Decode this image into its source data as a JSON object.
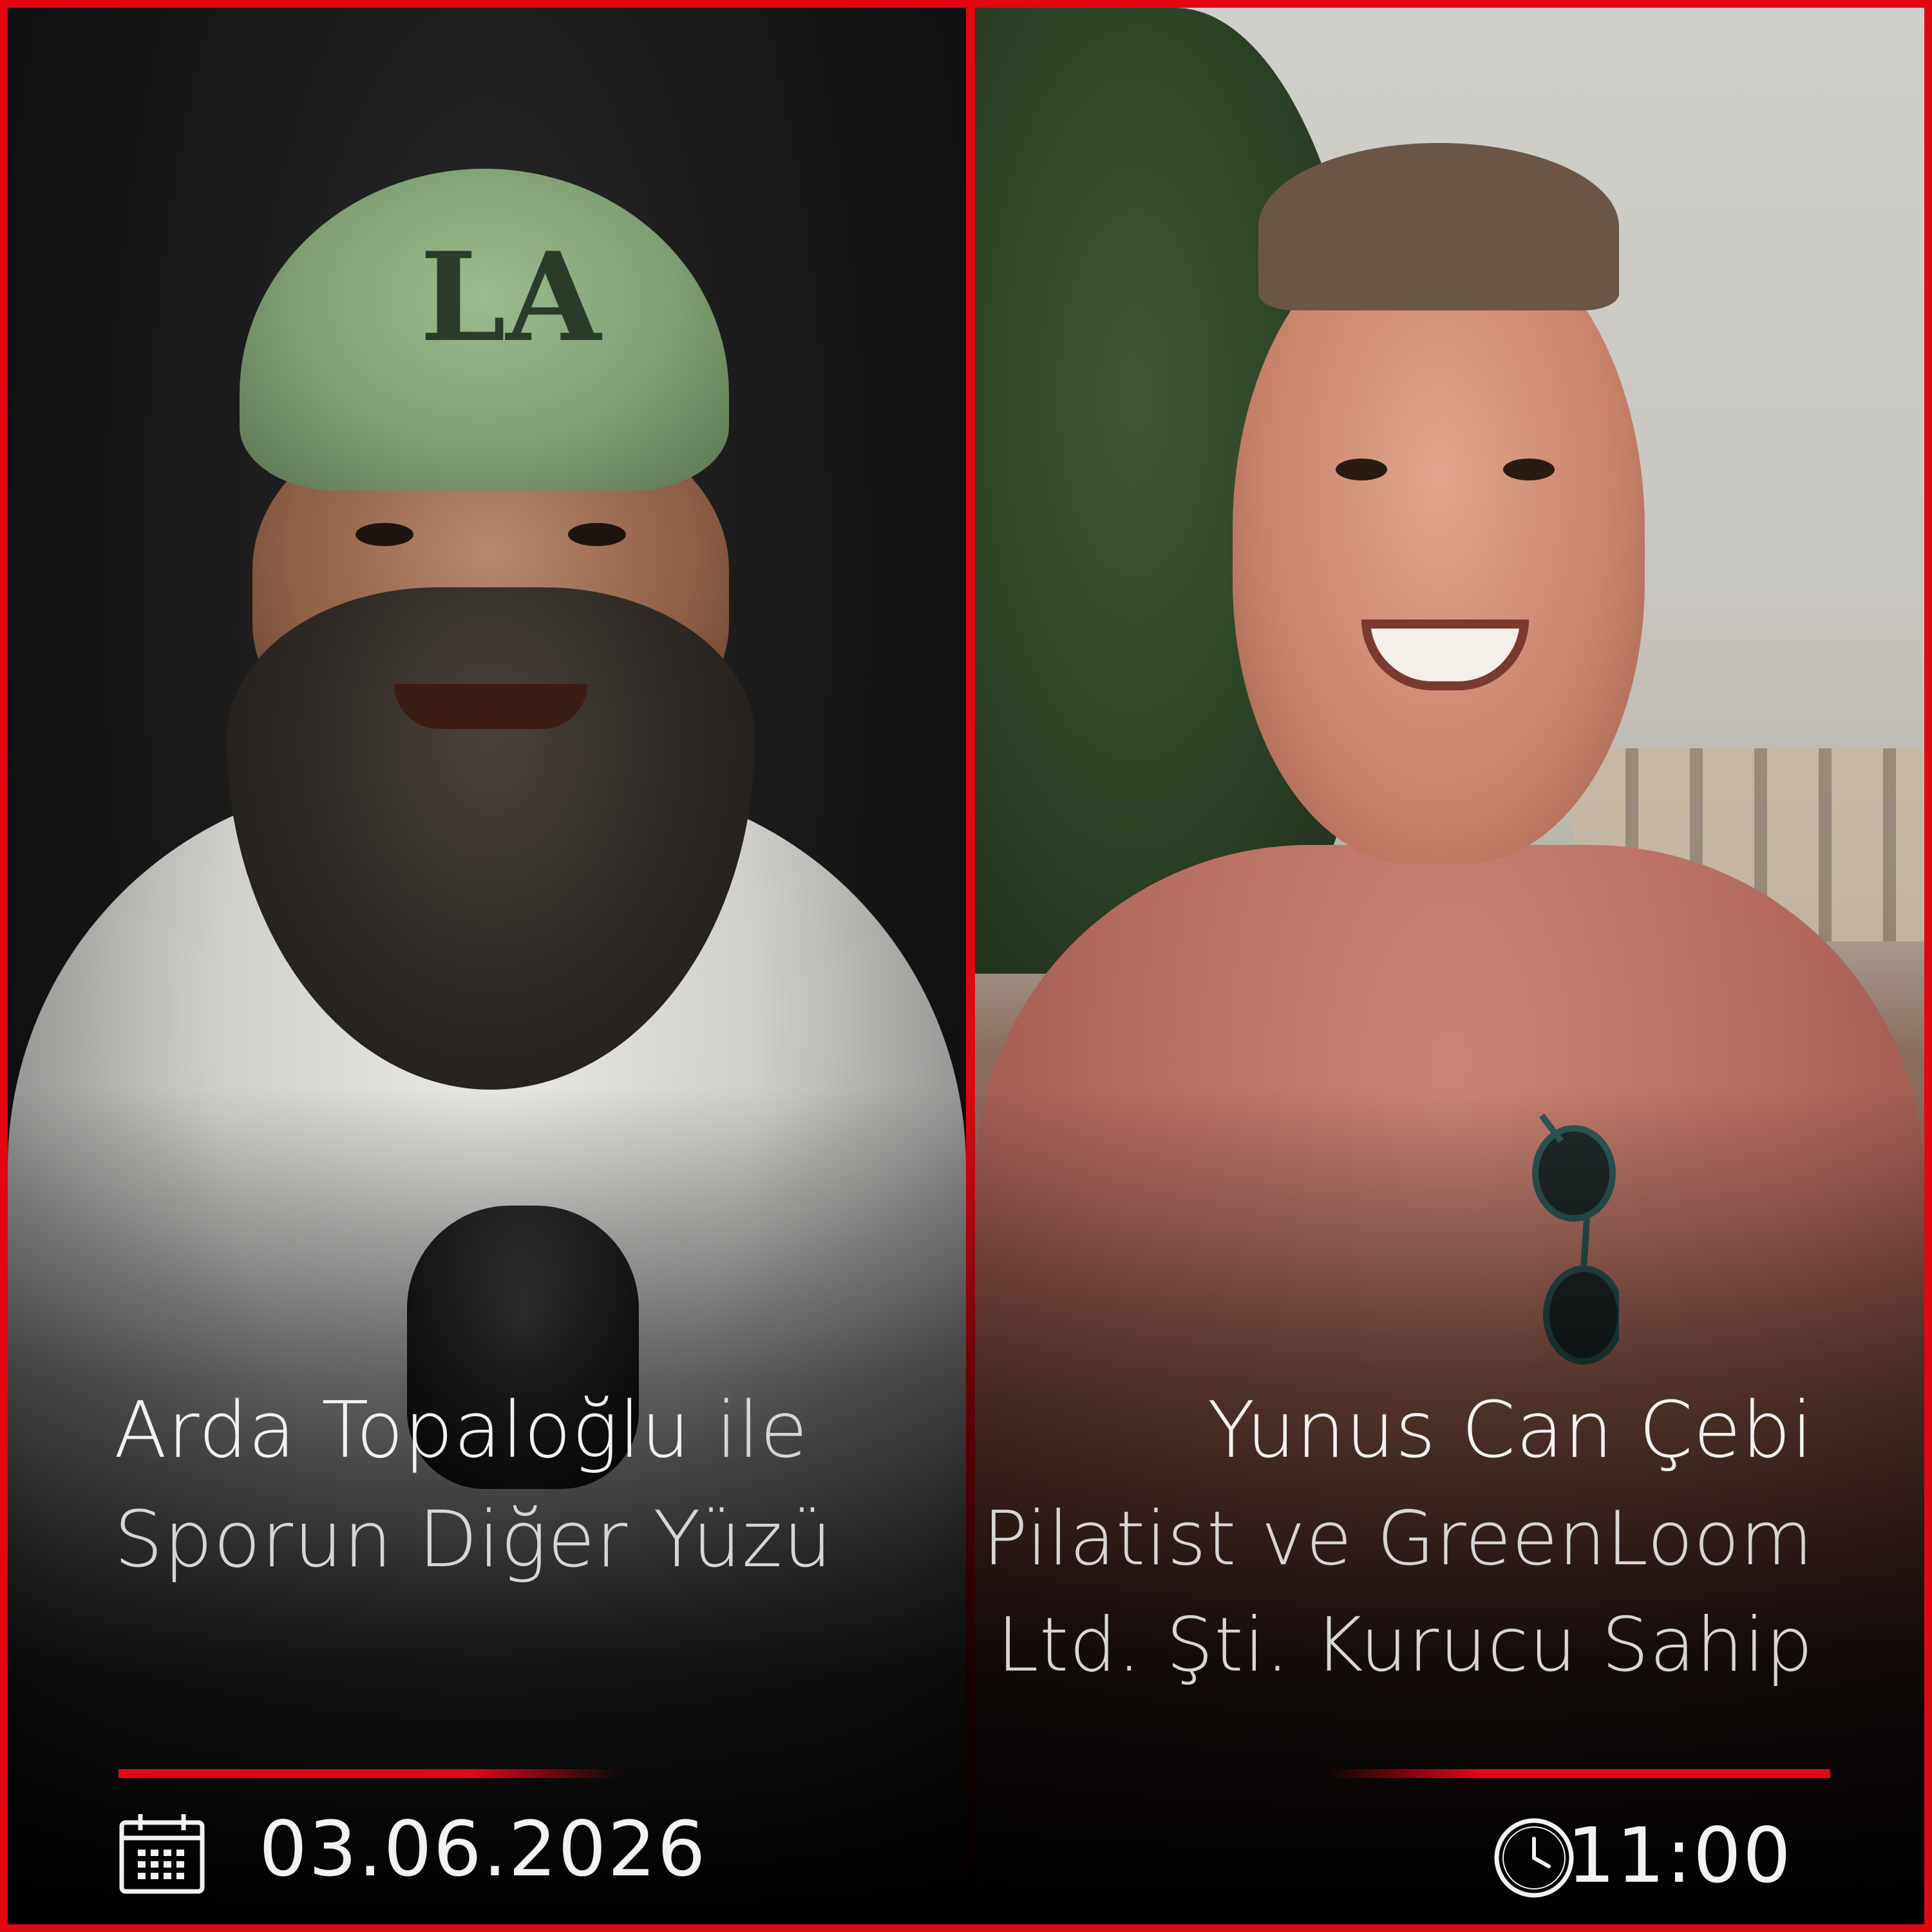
{
  "host": {
    "name": "Arda Topaloğlu",
    "connector": "ile",
    "show_title": "Sporun Diğer Yüzü",
    "cap_logo": "LA"
  },
  "guest": {
    "name": "Yunus Can Çebi",
    "role_line1": "Pilatist ve GreenLoom",
    "role_line2": "Ltd. Şti. Kurucu Sahip"
  },
  "event": {
    "date": "03.06.2026",
    "time": "11:00"
  },
  "icons": {
    "date_icon": "calendar-icon",
    "time_icon": "clock-icon"
  },
  "colors": {
    "accent": "#e30613",
    "text": "#f2f2f2",
    "background": "#000000"
  }
}
